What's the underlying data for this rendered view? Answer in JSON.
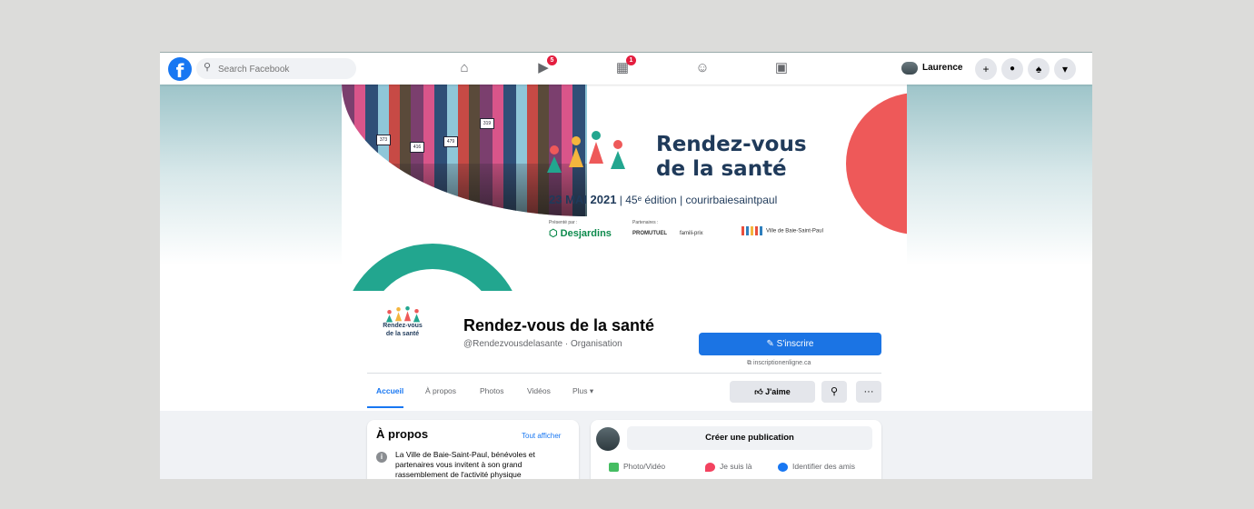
{
  "topbar": {
    "logo": "f",
    "search_placeholder": "Search Facebook",
    "nav": [
      {
        "icon": "home-icon",
        "glyph": "⌂",
        "badge": ""
      },
      {
        "icon": "watch-icon",
        "glyph": "▶",
        "badge": "5"
      },
      {
        "icon": "marketplace-icon",
        "glyph": "▦",
        "badge": "1"
      },
      {
        "icon": "groups-icon",
        "glyph": "☺",
        "badge": ""
      },
      {
        "icon": "gaming-icon",
        "glyph": "▣",
        "badge": ""
      }
    ],
    "user_name": "Laurence",
    "right_buttons": [
      {
        "icon": "plus-icon",
        "glyph": "+"
      },
      {
        "icon": "messenger-icon",
        "glyph": "●"
      },
      {
        "icon": "bell-icon",
        "glyph": "♠"
      },
      {
        "icon": "dropdown-icon",
        "glyph": "▾"
      }
    ]
  },
  "cover": {
    "title_line1": "Rendez-vous",
    "title_line2": "de la santé",
    "date": "23 MAI 2021",
    "edition": "| 45ᵉ édition | courirbaiesaintpaul",
    "presented_by": "Présenté par :",
    "partners_label": "Partenaires :",
    "sponsor1": "Desjardins",
    "sponsor2": "PROMUTUEL",
    "sponsor3": "famili-prix",
    "sponsor4": "Ville de Baie-Saint-Paul",
    "bibs": [
      "373",
      "416",
      "479",
      "319"
    ]
  },
  "page": {
    "profile_label_line1": "Rendez-vous",
    "profile_label_line2": "de la santé",
    "name": "Rendez-vous de la santé",
    "handle": "@Rendezvousdelasante · Organisation",
    "signup_label": "S'inscrire",
    "signup_link": "inscriptionenligne.ca",
    "tabs": [
      "Accueil",
      "À propos",
      "Photos",
      "Vidéos",
      "Plus ▾"
    ],
    "like_label": "J'aime"
  },
  "about": {
    "title": "À propos",
    "see_all": "Tout afficher",
    "text": "La Ville de Baie-Saint-Paul, bénévoles et partenaires vous invitent à son grand rassemblement de l'activité physique"
  },
  "composer": {
    "create_label": "Créer une publication",
    "actions": [
      {
        "label": "Photo/Vidéo",
        "color": "#45bd62"
      },
      {
        "label": "Je suis là",
        "color": "#f3425f"
      },
      {
        "label": "Identifier des amis",
        "color": "#1877f2"
      }
    ]
  },
  "colors": {
    "brand": "#1877f2",
    "teal": "#22a68f",
    "coral": "#ee5959",
    "navy": "#1f3a5a"
  }
}
